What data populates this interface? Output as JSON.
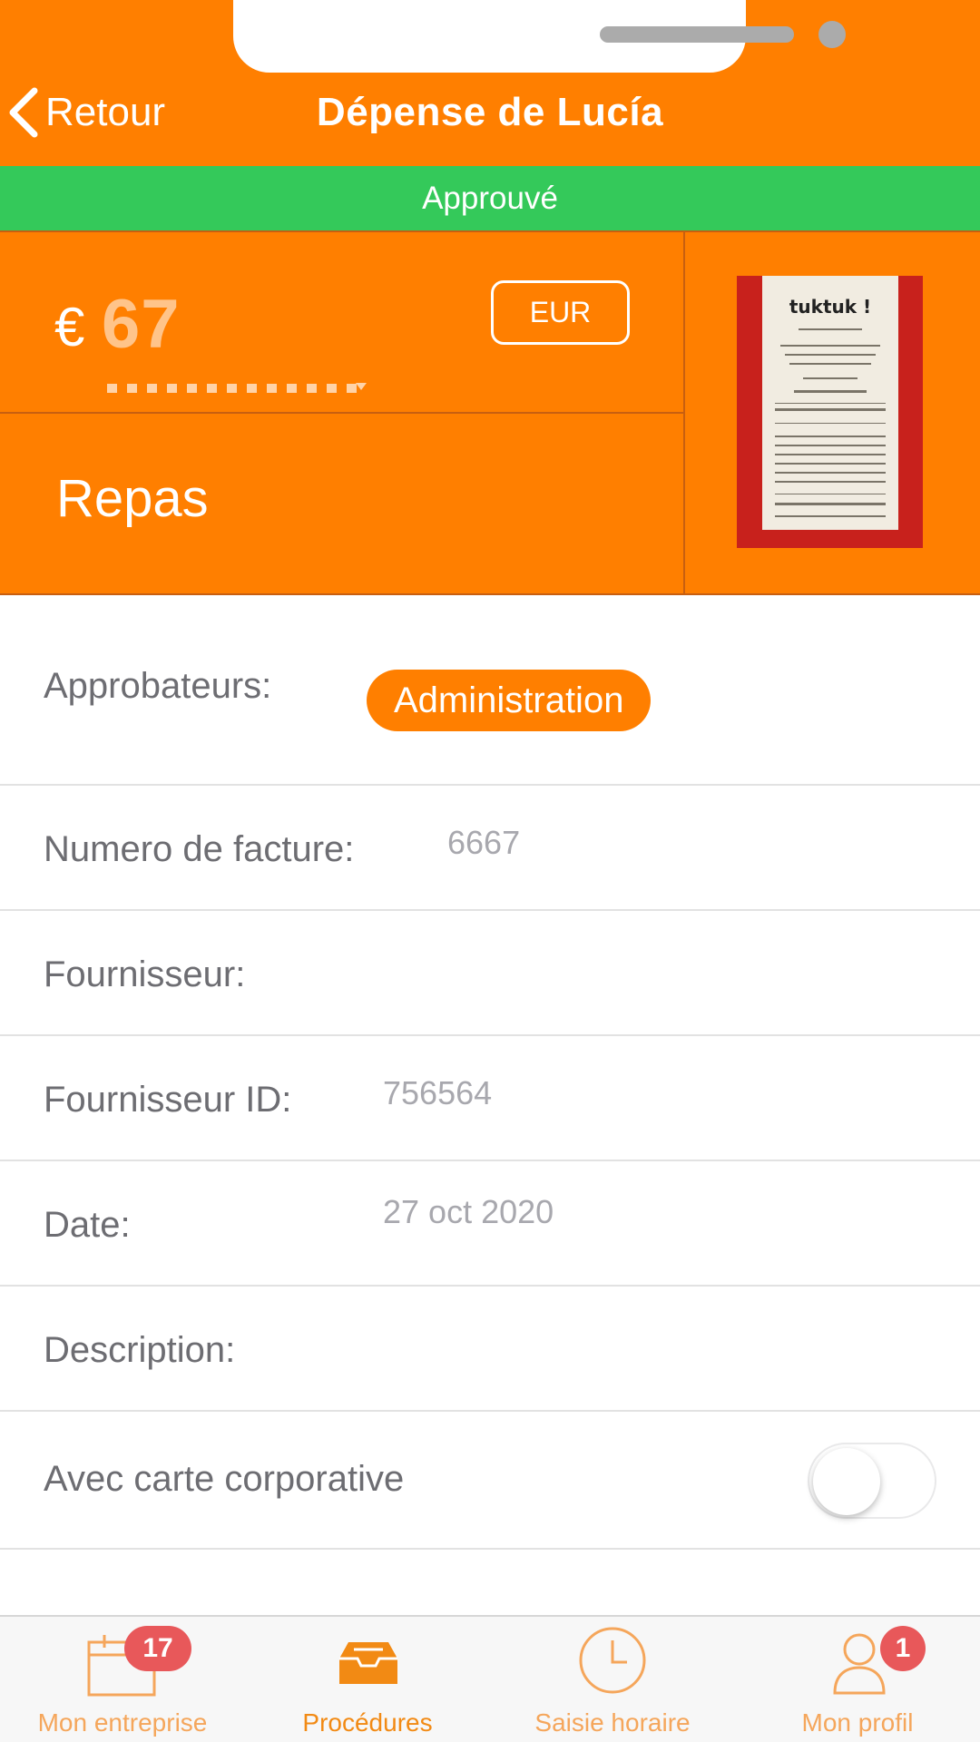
{
  "header": {
    "back_label": "Retour",
    "title": "Dépense de Lucía"
  },
  "status": "Approuvé",
  "expense": {
    "currency_symbol": "€",
    "amount": "67",
    "currency_code": "EUR",
    "category": "Repas",
    "receipt": {
      "brand": "tuktuk !"
    }
  },
  "details": {
    "approvers_label": "Approbateurs:",
    "approver": "Administration",
    "invoice_number_label": "Numero de facture:",
    "invoice_number": "6667",
    "supplier_label": "Fournisseur:",
    "supplier_id_label": "Fournisseur ID:",
    "supplier_id": "756564",
    "date_label": "Date:",
    "date": "27 oct 2020",
    "description_label": "Description:",
    "corporate_card_label": "Avec carte corporative",
    "corporate_card_enabled": false
  },
  "tabs": [
    {
      "label": "Mon entreprise",
      "icon": "calendar-icon",
      "badge": "17",
      "active": false
    },
    {
      "label": "Procédures",
      "icon": "inbox-tray-icon",
      "badge": "",
      "active": true
    },
    {
      "label": "Saisie horaire",
      "icon": "clock-icon",
      "badge": "",
      "active": false
    },
    {
      "label": "Mon profil",
      "icon": "user-icon",
      "badge": "1",
      "active": false
    }
  ],
  "colors": {
    "brand_orange": "#FF7F00",
    "approved_green": "#34C95A",
    "badge_red": "#E8585A"
  }
}
